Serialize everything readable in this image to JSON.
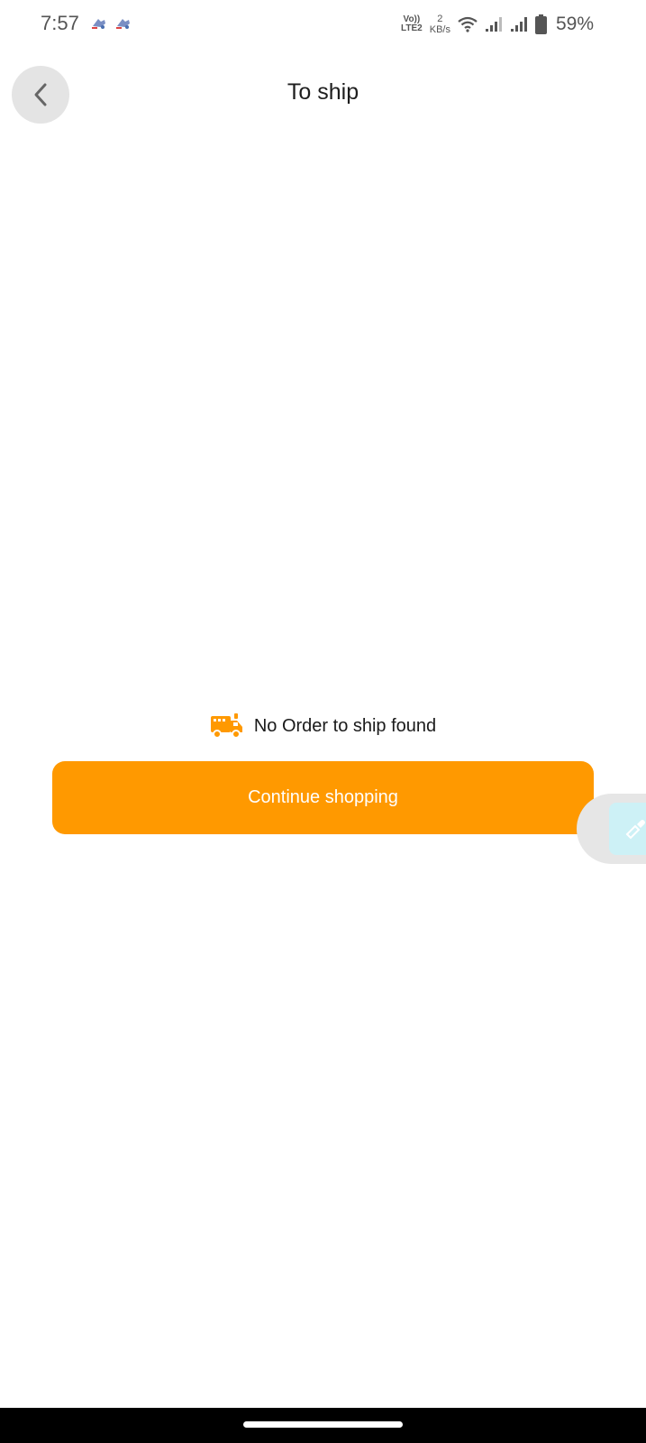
{
  "status_bar": {
    "time": "7:57",
    "volte_top": "Vo))",
    "volte_bottom": "LTE2",
    "net_speed_value": "2",
    "net_speed_unit": "KB/s",
    "battery": "59%"
  },
  "header": {
    "title": "To ship",
    "back_icon": "chevron-left-icon"
  },
  "empty_state": {
    "icon": "truck-icon",
    "message": "No Order to ship found"
  },
  "actions": {
    "continue_label": "Continue shopping"
  },
  "floating_widget": {
    "icon": "eyedropper-icon"
  },
  "colors": {
    "accent": "#ff9900",
    "float_bg": "#cdf1f6"
  }
}
